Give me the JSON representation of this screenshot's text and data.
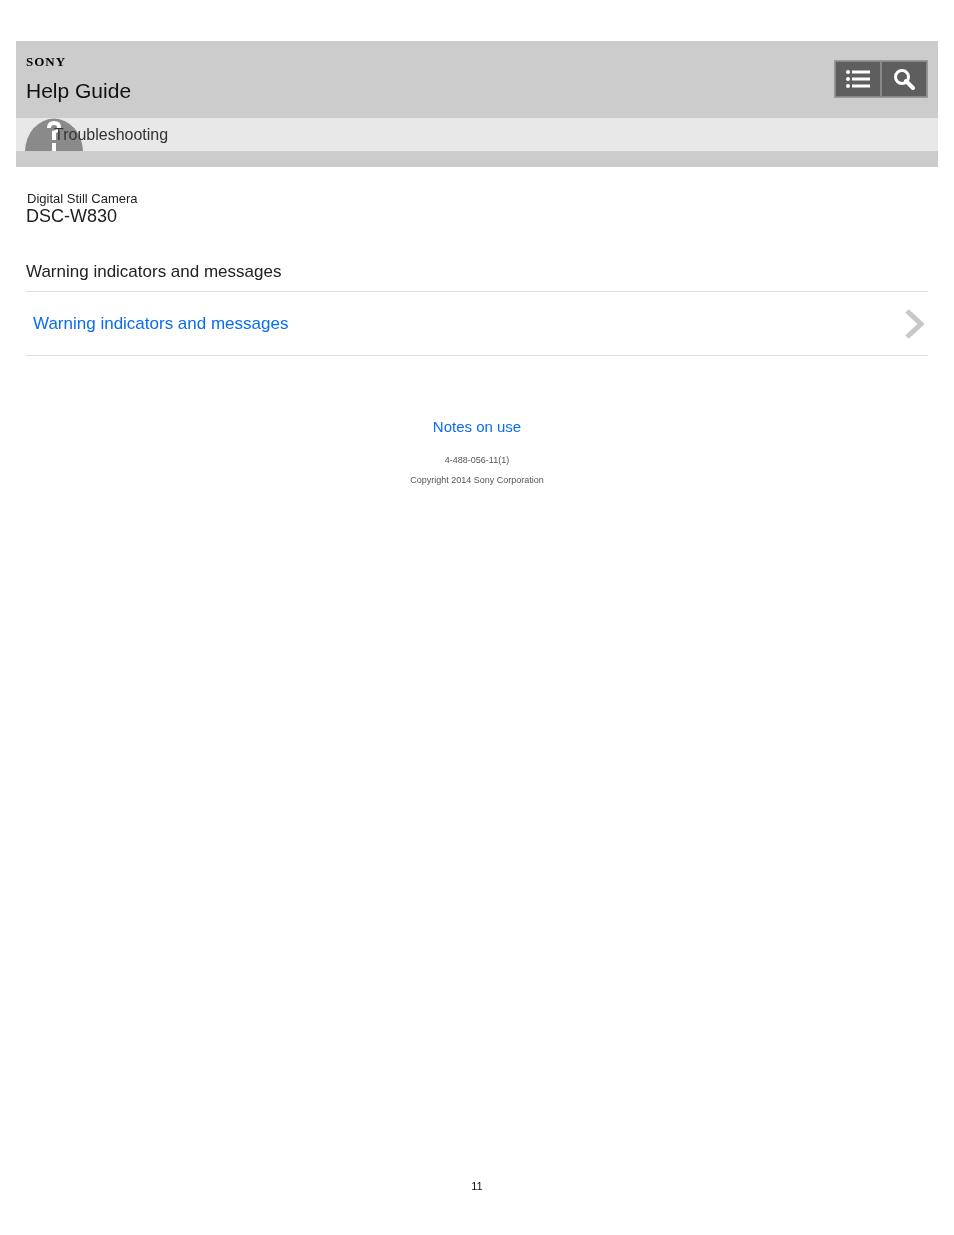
{
  "header": {
    "brand": "SONY",
    "title": "Help Guide"
  },
  "breadcrumb": {
    "label": "Troubleshooting"
  },
  "product": {
    "category": "Digital Still Camera",
    "model": "DSC-W830"
  },
  "section": {
    "heading": "Warning indicators and messages",
    "links": [
      {
        "label": "Warning indicators and messages"
      }
    ]
  },
  "footer": {
    "link": "Notes on use",
    "code": "4-488-056-11(1)",
    "copyright": "Copyright 2014 Sony Corporation"
  },
  "page_number": "11"
}
